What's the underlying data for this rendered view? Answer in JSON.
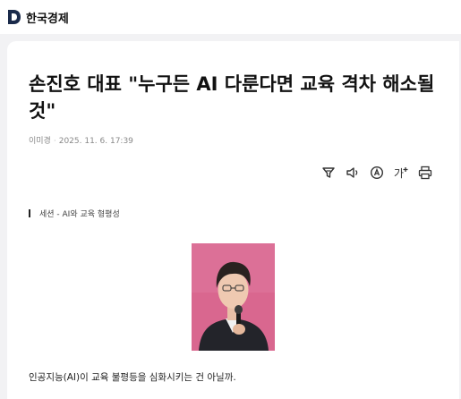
{
  "brand": {
    "name": "한국경제"
  },
  "article": {
    "title": "손진호 대표 \"누구든 AI 다룬다면 교육 격차 해소될 것\"",
    "author": "이미경",
    "datetime": "2025. 11. 6. 17:39",
    "section_tag": "세션 - AI와 교육 형평성",
    "lede": "인공지능(AI)이 교육 불평등을 심화시키는 건 아닐까."
  },
  "toolbar": {
    "icons": [
      "summary-filter-icon",
      "listen-audio-icon",
      "translate-icon",
      "font-size-icon",
      "print-icon"
    ],
    "font_size_glyph": "가"
  },
  "colors": {
    "page_background": "#f2f2f4",
    "card_background": "#ffffff",
    "logo_color": "#1a2a4a",
    "photo_background": "#d9678f"
  }
}
